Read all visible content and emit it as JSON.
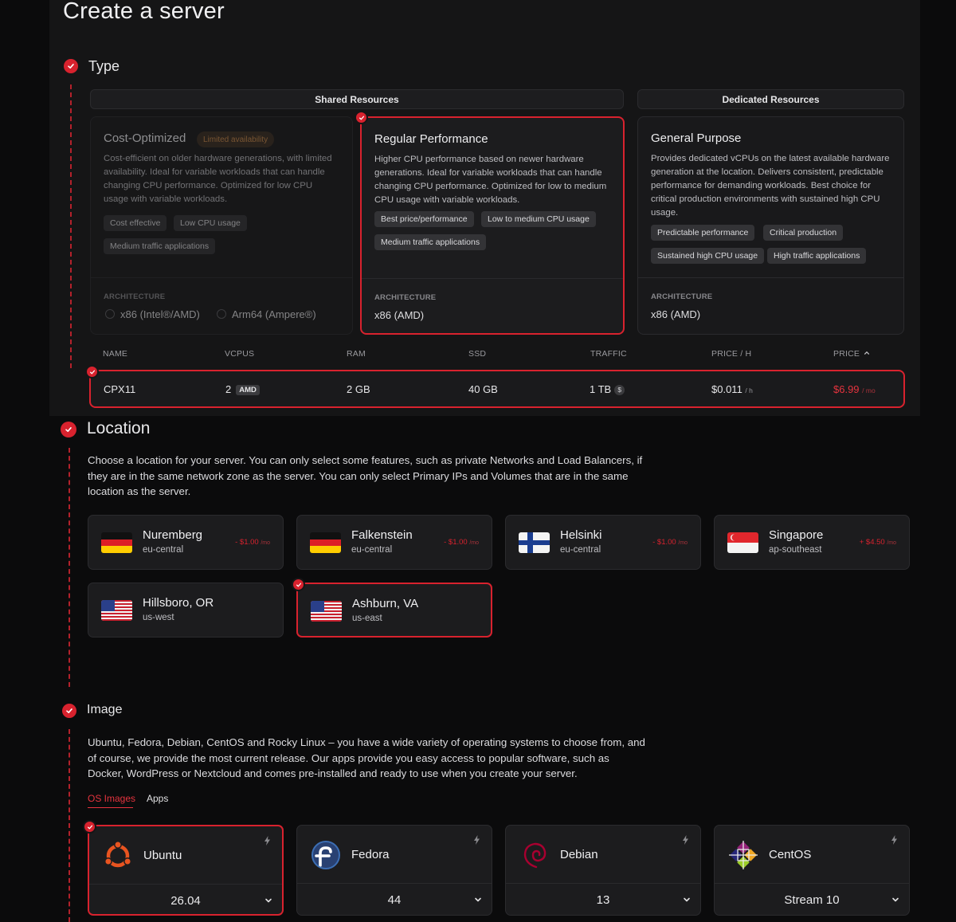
{
  "page": {
    "title": "Create a server"
  },
  "steps": {
    "type": "Type",
    "location": "Location",
    "image": "Image"
  },
  "type_section": {
    "shared_header": "Shared Resources",
    "dedicated_header": "Dedicated Resources",
    "cards": [
      {
        "title": "Cost-Optimized",
        "badge": "Limited availability",
        "description": "Cost-efficient on older hardware generations, with limited availability. Ideal for variable workloads that can handle changing CPU performance. Optimized for low CPU usage with variable workloads.",
        "tags": [
          "Cost effective",
          "Low CPU usage",
          "Medium traffic applications"
        ],
        "arch_label": "ARCHITECTURE",
        "arch_options": [
          "x86 (Intel®/AMD)",
          "Arm64 (Ampere®)"
        ]
      },
      {
        "title": "Regular Performance",
        "description": "Higher CPU performance based on newer hardware generations. Ideal for variable workloads that can handle changing CPU performance. Optimized for low to medium CPU usage with variable workloads.",
        "tags": [
          "Best price/performance",
          "Low to medium CPU usage",
          "Medium traffic applications"
        ],
        "arch_label": "ARCHITECTURE",
        "arch_value": "x86 (AMD)"
      },
      {
        "title": "General Purpose",
        "description": "Provides dedicated vCPUs on the latest available hardware generation at the location. Delivers consistent, predictable performance for demanding workloads. Best choice for critical production environments with sustained high CPU usage.",
        "tags": [
          "Predictable performance",
          "Critical production",
          "Sustained high CPU usage",
          "High traffic applications"
        ],
        "arch_label": "ARCHITECTURE",
        "arch_value": "x86 (AMD)"
      }
    ]
  },
  "server_table": {
    "columns": [
      "NAME",
      "VCPUS",
      "RAM",
      "SSD",
      "TRAFFIC",
      "PRICE / H",
      "PRICE"
    ],
    "sort_indicator": "^",
    "row": {
      "name": "CPX11",
      "vcpus": "2",
      "vcpu_badge": "AMD",
      "ram": "2 GB",
      "ssd": "40 GB",
      "traffic": "1 TB",
      "traffic_icon": "$",
      "price_h": "$0.011",
      "price_h_unit": "/ h",
      "price": "$6.99",
      "price_unit": "/ mo"
    }
  },
  "location_section": {
    "description": "Choose a location for your server. You can only select some features, such as private Networks and Load Balancers, if they are in the same network zone as the server. You can only select Primary IPs and Volumes that are in the same location as the server.",
    "locations": [
      {
        "name": "Nuremberg",
        "zone": "eu-central",
        "price": "- $1.00",
        "unit": "/mo",
        "flag": "germany-flag"
      },
      {
        "name": "Falkenstein",
        "zone": "eu-central",
        "price": "- $1.00",
        "unit": "/mo",
        "flag": "germany-flag"
      },
      {
        "name": "Helsinki",
        "zone": "eu-central",
        "price": "- $1.00",
        "unit": "/mo",
        "flag": "finland-flag"
      },
      {
        "name": "Singapore",
        "zone": "ap-southeast",
        "price": "+ $4.50",
        "unit": "/mo",
        "flag": "singapore-flag"
      },
      {
        "name": "Hillsboro, OR",
        "zone": "us-west",
        "flag": "usa-flag"
      },
      {
        "name": "Ashburn, VA",
        "zone": "us-east",
        "flag": "usa-flag"
      }
    ]
  },
  "image_section": {
    "description": "Ubuntu, Fedora, Debian, CentOS and Rocky Linux – you have a wide variety of operating systems to choose from, and of course, we provide the most current release. Our apps provide you easy access to popular software, such as Docker, WordPress or Nextcloud and comes pre-installed and ready to use when you create your server.",
    "tabs": [
      "OS Images",
      "Apps"
    ],
    "os": [
      {
        "name": "Ubuntu",
        "version": "26.04",
        "icon": "ubuntu-logo-icon"
      },
      {
        "name": "Fedora",
        "version": "44",
        "icon": "fedora-logo-icon"
      },
      {
        "name": "Debian",
        "version": "13",
        "icon": "debian-logo-icon"
      },
      {
        "name": "CentOS",
        "version": "Stream 10",
        "icon": "centos-logo-icon"
      }
    ]
  },
  "colors": {
    "accent": "#d8222e",
    "background": "#0b0b0c",
    "panel": "#151516",
    "card": "#1c1c1e"
  }
}
